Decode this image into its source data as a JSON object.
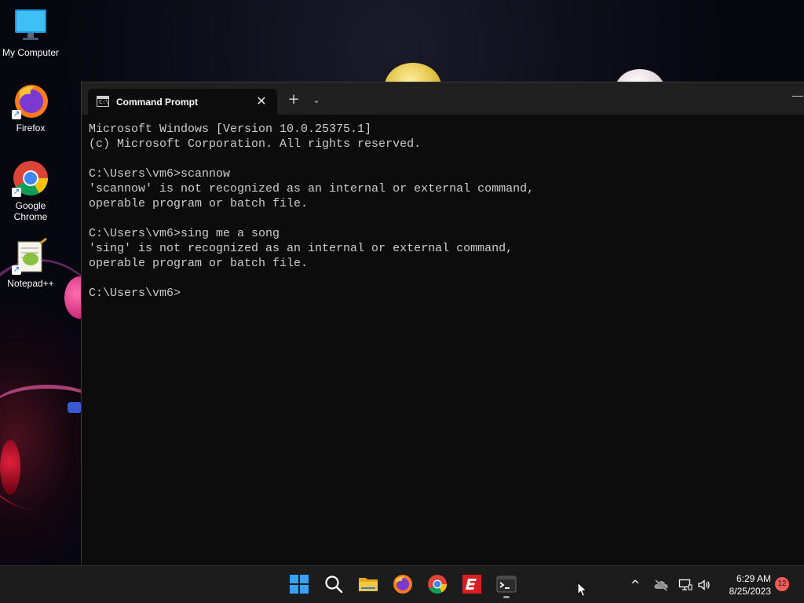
{
  "desktop": {
    "icons": [
      {
        "label": "My Computer",
        "icon": "monitor-icon"
      },
      {
        "label": "Firefox",
        "icon": "firefox-icon"
      },
      {
        "label": "Google\nChrome",
        "icon": "chrome-icon"
      },
      {
        "label": "Notepad++",
        "icon": "notepadpp-icon"
      }
    ]
  },
  "window": {
    "tab_title": "Command Prompt",
    "tab_icon_text": "C:\\",
    "close_glyph": "✕",
    "newtab_glyph": "+",
    "dropdown_glyph": "⌄",
    "minimize_glyph": "—",
    "console_lines": [
      "Microsoft Windows [Version 10.0.25375.1]",
      "(c) Microsoft Corporation. All rights reserved.",
      "",
      "C:\\Users\\vm6>scannow",
      "'scannow' is not recognized as an internal or external command,",
      "operable program or batch file.",
      "",
      "C:\\Users\\vm6>sing me a song",
      "'sing' is not recognized as an internal or external command,",
      "operable program or batch file.",
      "",
      "C:\\Users\\vm6>"
    ]
  },
  "taskbar": {
    "apps": [
      "start-icon",
      "search-icon",
      "file-explorer-icon",
      "firefox-icon",
      "chrome-icon",
      "red-app-icon",
      "terminal-icon"
    ],
    "tray": {
      "chevron": "^",
      "time": "6:29 AM",
      "date": "8/25/2023",
      "notifications": "12"
    }
  },
  "colors": {
    "console_bg": "#0c0c0c",
    "console_text": "#cccccc",
    "taskbar_bg": "#1c1c1c",
    "notif_badge": "#f25c54"
  }
}
